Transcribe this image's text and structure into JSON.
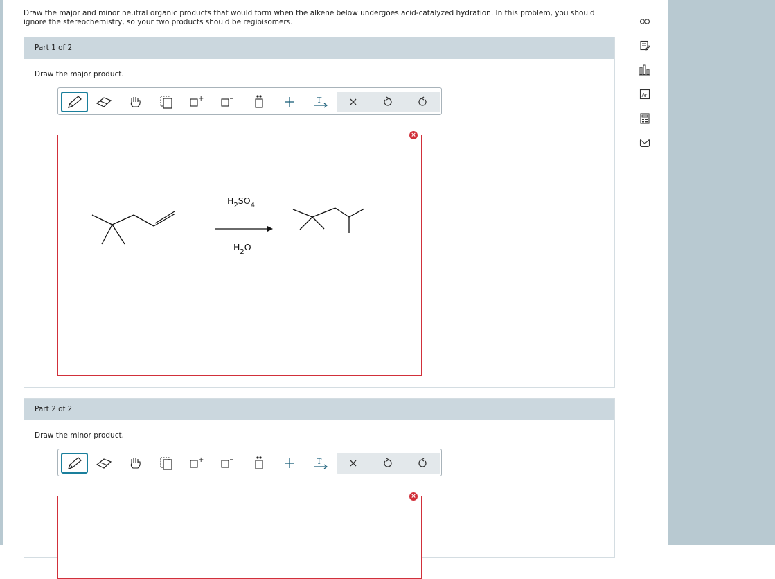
{
  "question": {
    "text": "Draw the major and minor neutral organic products that would form when the alkene below undergoes acid-catalyzed hydration. In this problem, you should ignore the stereochemistry, so your two products should be regioisomers."
  },
  "parts": [
    {
      "header": "Part 1 of 2",
      "prompt": "Draw the major product."
    },
    {
      "header": "Part 2 of 2",
      "prompt": "Draw the minor product."
    }
  ],
  "reaction": {
    "reagent_top_main": "H",
    "reagent_top_sub1": "2",
    "reagent_top_main2": "SO",
    "reagent_top_sub2": "4",
    "reagent_bottom_main": "H",
    "reagent_bottom_sub": "2",
    "reagent_bottom_main2": "O"
  },
  "toolbar": {
    "tools": [
      "pencil-icon",
      "eraser-icon",
      "hand-icon",
      "copy-icon",
      "positive-charge-icon",
      "negative-charge-icon",
      "lone-pair-icon",
      "plus-icon",
      "text-arrow-icon",
      "clear-icon",
      "undo-icon",
      "redo-icon"
    ],
    "text_tool_label": "T",
    "plus_label": "+",
    "clear_label": "×",
    "charge_plus": "+",
    "charge_minus": "−"
  },
  "error_marker": "×",
  "sidebar": {
    "icons": [
      "glasses-icon",
      "notes-icon",
      "chart-icon",
      "periodic-table-icon",
      "calculator-icon",
      "mail-icon"
    ]
  },
  "colors": {
    "accent": "#1a7f9c",
    "error": "#d1303a",
    "header_bg": "#cbd7de",
    "side_bg": "#b8c9d1"
  }
}
